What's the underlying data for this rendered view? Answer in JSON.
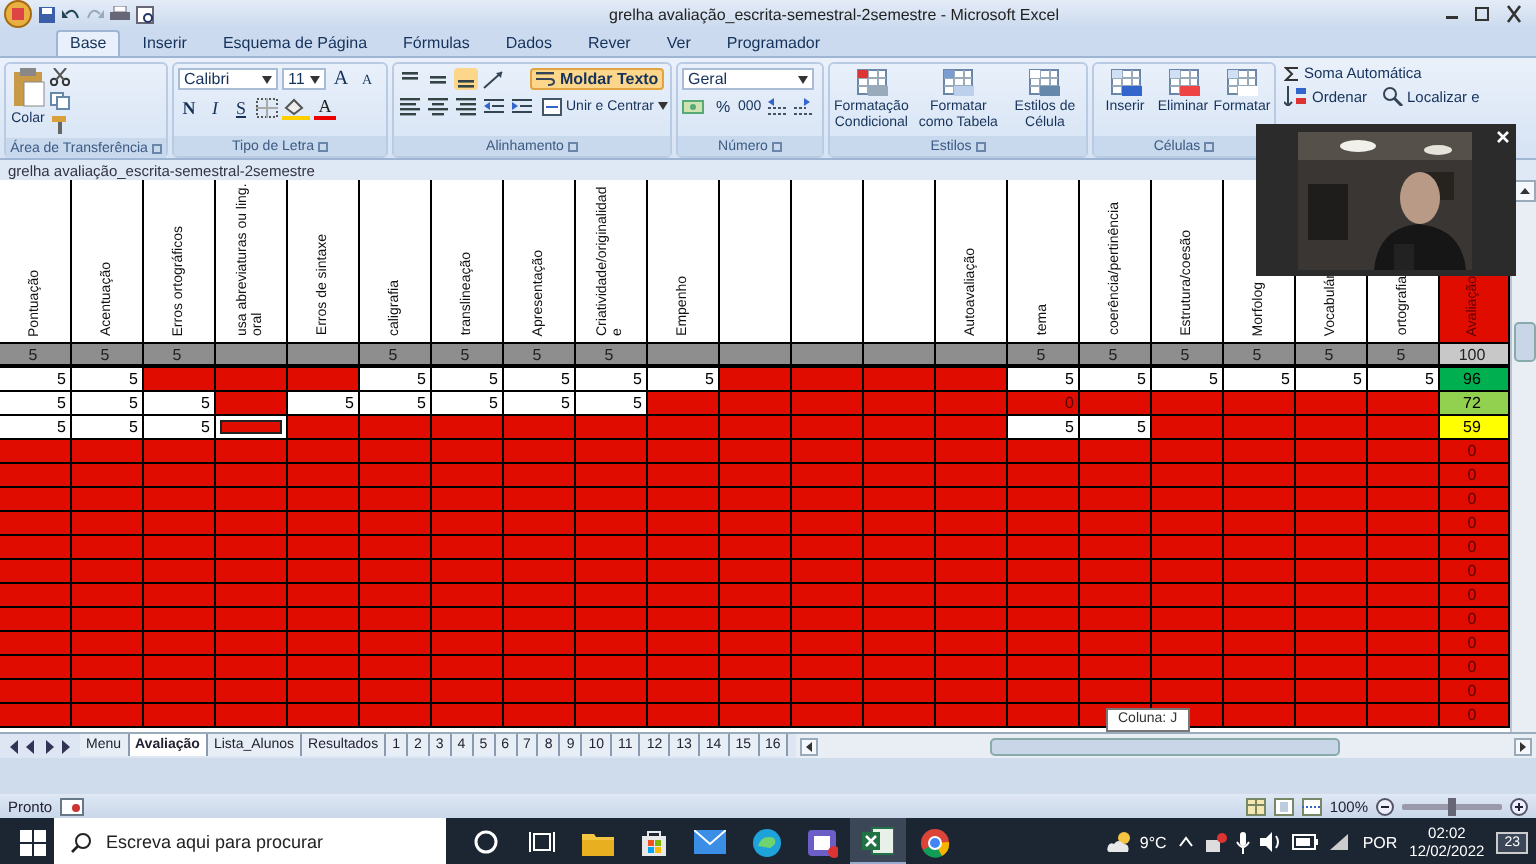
{
  "window": {
    "title": "grelha avaliação_escrita-semestral-2semestre - Microsoft Excel"
  },
  "ribbon_tabs": [
    {
      "label": "Base",
      "selected": true
    },
    {
      "label": "Inserir",
      "selected": false
    },
    {
      "label": "Esquema de Página",
      "selected": false
    },
    {
      "label": "Fórmulas",
      "selected": false
    },
    {
      "label": "Dados",
      "selected": false
    },
    {
      "label": "Rever",
      "selected": false
    },
    {
      "label": "Ver",
      "selected": false
    },
    {
      "label": "Programador",
      "selected": false
    }
  ],
  "ribbon": {
    "clipboard": {
      "paste": "Colar",
      "group": "Área de Transferência"
    },
    "font": {
      "name": "Calibri",
      "size": "11",
      "grow": "A",
      "shrink": "A",
      "bold": "N",
      "italic": "I",
      "underline": "S",
      "color_letter": "A",
      "group": "Tipo de Letra"
    },
    "alignment": {
      "vertical": [
        {
          "selected": false
        },
        {
          "selected": false
        },
        {
          "selected": true
        }
      ],
      "wrap_text": {
        "label": "Moldar Texto",
        "on": true
      },
      "merge": "Unir e Centrar",
      "group": "Alinhamento"
    },
    "number": {
      "format": "Geral",
      "percent": "%",
      "thousands": "000",
      "group": "Número"
    },
    "styles": {
      "buttons": [
        "Formatação Condicional",
        "Formatar como Tabela",
        "Estilos de Célula"
      ],
      "group": "Estilos"
    },
    "cells": {
      "buttons": [
        "Inserir",
        "Eliminar",
        "Formatar"
      ],
      "group": "Células"
    },
    "editing": {
      "autosum": "Soma Automática",
      "buttons": [
        "Ordenar",
        "Localizar e"
      ]
    }
  },
  "workbook": {
    "title": "grelha avaliação_escrita-semestral-2semestre"
  },
  "sheet": {
    "columns": [
      {
        "kind": "label",
        "label": "Pontuação"
      },
      {
        "kind": "label",
        "label": "Acentuação"
      },
      {
        "kind": "label",
        "label": "Erros ortográficos"
      },
      {
        "kind": "label",
        "label": "usa abreviaturas ou ling. oral"
      },
      {
        "kind": "label",
        "label": "Erros de sintaxe"
      },
      {
        "kind": "label",
        "label": "caligrafia"
      },
      {
        "kind": "label",
        "label": "translineação"
      },
      {
        "kind": "label",
        "label": "Apresentação"
      },
      {
        "kind": "label",
        "label": "Criatividade/originalidade"
      },
      {
        "kind": "label",
        "label": "Empenho"
      },
      {
        "kind": "blank"
      },
      {
        "kind": "blank"
      },
      {
        "kind": "blank"
      },
      {
        "kind": "label",
        "label": "Autoavaliação"
      },
      {
        "kind": "label",
        "label": "tema"
      },
      {
        "kind": "label",
        "label": "coerência/pertinência"
      },
      {
        "kind": "label",
        "label": "Estrutura/coesão"
      },
      {
        "kind": "label",
        "label": "Morfolog"
      },
      {
        "kind": "label",
        "label": "Vocabulár"
      },
      {
        "kind": "label",
        "label": "ortografia"
      },
      {
        "kind": "label",
        "label": "Avaliação"
      }
    ],
    "max_scores": [
      {
        "kind": "score",
        "value": "5"
      },
      {
        "kind": "score",
        "value": "5"
      },
      {
        "kind": "score",
        "value": "5"
      },
      {
        "kind": "blank"
      },
      {
        "kind": "blank"
      },
      {
        "kind": "score",
        "value": "5"
      },
      {
        "kind": "score",
        "value": "5"
      },
      {
        "kind": "score",
        "value": "5"
      },
      {
        "kind": "score",
        "value": "5"
      },
      {
        "kind": "blank"
      },
      {
        "kind": "blank"
      },
      {
        "kind": "blank"
      },
      {
        "kind": "blank"
      },
      {
        "kind": "blank"
      },
      {
        "kind": "score",
        "value": "5"
      },
      {
        "kind": "score",
        "value": "5"
      },
      {
        "kind": "score",
        "value": "5"
      },
      {
        "kind": "score",
        "value": "5"
      },
      {
        "kind": "score",
        "value": "5"
      },
      {
        "kind": "score",
        "value": "5"
      },
      {
        "kind": "score",
        "value": "100"
      }
    ],
    "rows": [
      {
        "kind": "data",
        "grade": {
          "value": "96",
          "color": "#00b050"
        },
        "cells": [
          {
            "value": "5",
            "highlighted": false,
            "selected": false
          },
          {
            "value": "5",
            "highlighted": false,
            "selected": false
          },
          {
            "highlighted": true,
            "selected": false
          },
          {
            "highlighted": true,
            "selected": false
          },
          {
            "highlighted": true,
            "selected": false
          },
          {
            "value": "5",
            "highlighted": false,
            "selected": false
          },
          {
            "value": "5",
            "highlighted": false,
            "selected": false
          },
          {
            "value": "5",
            "highlighted": false,
            "selected": false
          },
          {
            "value": "5",
            "highlighted": false,
            "selected": false
          },
          {
            "value": "5",
            "highlighted": false,
            "selected": false
          },
          {
            "highlighted": true,
            "selected": false
          },
          {
            "highlighted": true,
            "selected": false
          },
          {
            "highlighted": true,
            "selected": false
          },
          {
            "highlighted": true,
            "selected": false
          },
          {
            "value": "5",
            "highlighted": false,
            "selected": false
          },
          {
            "value": "5",
            "highlighted": false,
            "selected": false
          },
          {
            "value": "5",
            "highlighted": false,
            "selected": false
          },
          {
            "value": "5",
            "highlighted": false,
            "selected": false
          },
          {
            "value": "5",
            "highlighted": false,
            "selected": false
          },
          {
            "value": "5",
            "highlighted": false,
            "selected": false
          }
        ]
      },
      {
        "kind": "data",
        "grade": {
          "value": "72",
          "color": "#92d050"
        },
        "cells": [
          {
            "value": "5",
            "highlighted": false,
            "selected": false
          },
          {
            "value": "5",
            "highlighted": false,
            "selected": false
          },
          {
            "value": "5",
            "highlighted": false,
            "selected": false
          },
          {
            "highlighted": true,
            "selected": false
          },
          {
            "value": "5",
            "highlighted": false,
            "selected": false
          },
          {
            "value": "5",
            "highlighted": false,
            "selected": false
          },
          {
            "value": "5",
            "highlighted": false,
            "selected": false
          },
          {
            "value": "5",
            "highlighted": false,
            "selected": false
          },
          {
            "value": "5",
            "highlighted": false,
            "selected": false
          },
          {
            "highlighted": true,
            "selected": false
          },
          {
            "highlighted": true,
            "selected": false
          },
          {
            "highlighted": true,
            "selected": false
          },
          {
            "highlighted": true,
            "selected": false
          },
          {
            "highlighted": true,
            "selected": false
          },
          {
            "value": "0",
            "highlighted": true,
            "selected": false
          },
          {
            "highlighted": true,
            "selected": false
          },
          {
            "highlighted": true,
            "selected": false
          },
          {
            "highlighted": true,
            "selected": false
          },
          {
            "highlighted": true,
            "selected": false
          },
          {
            "highlighted": true,
            "selected": false
          }
        ]
      },
      {
        "kind": "data",
        "grade": {
          "value": "59",
          "color": "#ffff00"
        },
        "cells": [
          {
            "value": "5",
            "highlighted": false,
            "selected": false
          },
          {
            "value": "5",
            "highlighted": false,
            "selected": false
          },
          {
            "value": "5",
            "highlighted": false,
            "selected": false
          },
          {
            "highlighted": true,
            "selected": true
          },
          {
            "highlighted": true,
            "selected": false
          },
          {
            "highlighted": true,
            "selected": false
          },
          {
            "highlighted": true,
            "selected": false
          },
          {
            "highlighted": true,
            "selected": false
          },
          {
            "highlighted": true,
            "selected": false
          },
          {
            "highlighted": true,
            "selected": false
          },
          {
            "highlighted": true,
            "selected": false
          },
          {
            "highlighted": true,
            "selected": false
          },
          {
            "highlighted": true,
            "selected": false
          },
          {
            "highlighted": true,
            "selected": false
          },
          {
            "value": "5",
            "highlighted": false,
            "selected": false
          },
          {
            "value": "5",
            "highlighted": false,
            "selected": false
          },
          {
            "highlighted": true,
            "selected": false
          },
          {
            "highlighted": true,
            "selected": false
          },
          {
            "highlighted": true,
            "selected": false
          },
          {
            "highlighted": true,
            "selected": false
          }
        ]
      },
      {
        "kind": "empty",
        "highlighted": true,
        "grade": {
          "value": "0",
          "color": "#e00c00"
        }
      },
      {
        "kind": "empty",
        "highlighted": true,
        "grade": {
          "value": "0",
          "color": "#e00c00"
        }
      },
      {
        "kind": "empty",
        "highlighted": true,
        "grade": {
          "value": "0",
          "color": "#e00c00"
        }
      },
      {
        "kind": "empty",
        "highlighted": true,
        "grade": {
          "value": "0",
          "color": "#e00c00"
        }
      },
      {
        "kind": "empty",
        "highlighted": true,
        "grade": {
          "value": "0",
          "color": "#e00c00"
        }
      },
      {
        "kind": "empty",
        "highlighted": true,
        "grade": {
          "value": "0",
          "color": "#e00c00"
        }
      },
      {
        "kind": "empty",
        "highlighted": true,
        "grade": {
          "value": "0",
          "color": "#e00c00"
        }
      },
      {
        "kind": "empty",
        "highlighted": true,
        "grade": {
          "value": "0",
          "color": "#e00c00"
        }
      },
      {
        "kind": "empty",
        "highlighted": true,
        "grade": {
          "value": "0",
          "color": "#e00c00"
        }
      },
      {
        "kind": "empty",
        "highlighted": true,
        "grade": {
          "value": "0",
          "color": "#e00c00"
        }
      },
      {
        "kind": "empty",
        "highlighted": true,
        "grade": {
          "value": "0",
          "color": "#e00c00"
        }
      },
      {
        "kind": "empty",
        "highlighted": true,
        "grade": {
          "value": "0",
          "color": "#e00c00"
        }
      }
    ]
  },
  "tooltip": "Coluna: J",
  "sheet_tabs": [
    {
      "label": "Menu",
      "selected": false
    },
    {
      "label": "Avaliação",
      "selected": true
    },
    {
      "label": "Lista_Alunos",
      "selected": false
    },
    {
      "label": "Resultados",
      "selected": false
    },
    {
      "label": "1",
      "selected": false
    },
    {
      "label": "2",
      "selected": false
    },
    {
      "label": "3",
      "selected": false
    },
    {
      "label": "4",
      "selected": false
    },
    {
      "label": "5",
      "selected": false
    },
    {
      "label": "6",
      "selected": false
    },
    {
      "label": "7",
      "selected": false
    },
    {
      "label": "8",
      "selected": false
    },
    {
      "label": "9",
      "selected": false
    },
    {
      "label": "10",
      "selected": false
    },
    {
      "label": "11",
      "selected": false
    },
    {
      "label": "12",
      "selected": false
    },
    {
      "label": "13",
      "selected": false
    },
    {
      "label": "14",
      "selected": false
    },
    {
      "label": "15",
      "selected": false
    },
    {
      "label": "16",
      "selected": false
    }
  ],
  "status_bar": {
    "text": "Pronto",
    "zoom": "100%",
    "zoom_slider": {
      "level": 0.5
    }
  },
  "taskbar": {
    "search": {
      "placeholder": "Escreva aqui para procurar"
    },
    "apps": [
      {
        "kind": "cortana",
        "active": false
      },
      {
        "kind": "taskview",
        "active": false
      },
      {
        "kind": "explorer",
        "active": false
      },
      {
        "kind": "store",
        "active": false
      },
      {
        "kind": "mail",
        "active": false
      },
      {
        "kind": "edge",
        "active": false
      },
      {
        "kind": "teams",
        "active": false
      },
      {
        "kind": "excel",
        "active": true
      },
      {
        "kind": "chrome",
        "active": false
      }
    ],
    "temperature": "9°C",
    "language": "POR",
    "time": "02:02",
    "date": "12/02/2022",
    "notifications": "23"
  }
}
